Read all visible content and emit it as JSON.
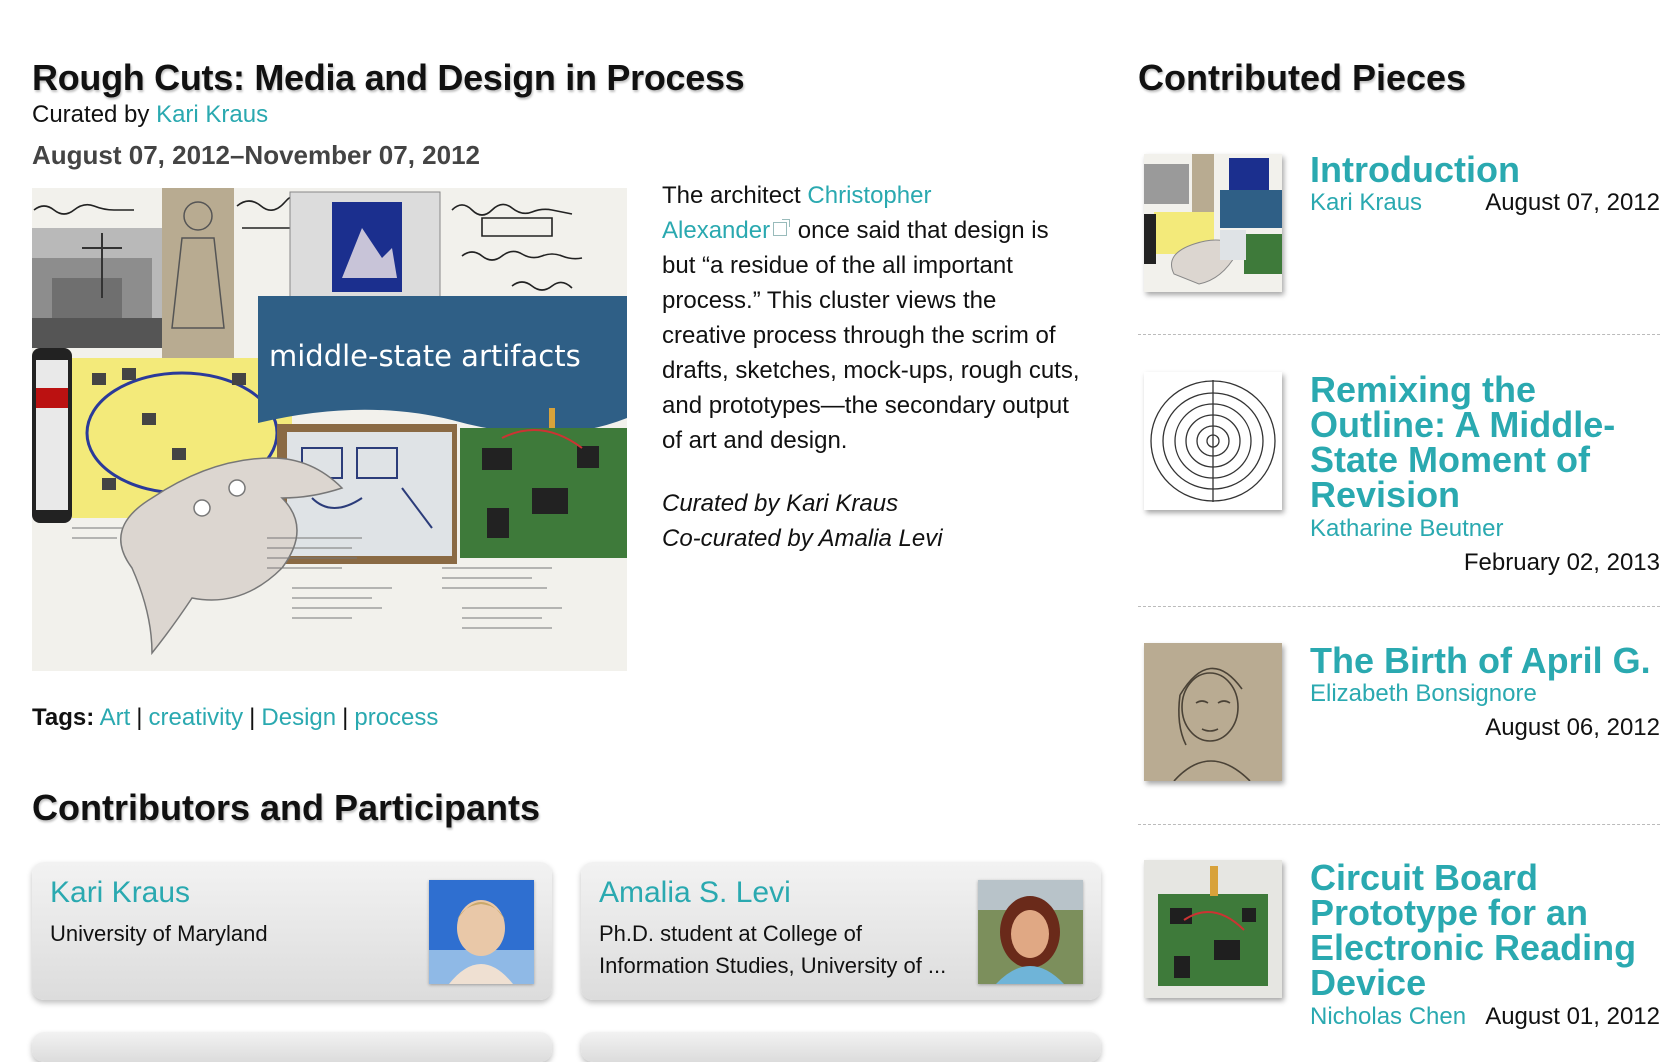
{
  "exhibit": {
    "title": "Rough Cuts: Media and Design in Process",
    "curated_prefix": "Curated by ",
    "curator": "Kari Kraus",
    "date_range": "August 07, 2012–November 07, 2012",
    "image_banner_text": "middle-state artifacts"
  },
  "description": {
    "intro": "The architect ",
    "link_text_1": "Christopher",
    "link_text_2": "Alexander",
    "body": " once said that design is but “a residue of the all important process.” This cluster views the creative process through the scrim of drafts, sketches, mock-ups, rough cuts, and prototypes—the secondary output of art and design.",
    "curated_line": "Curated by Kari Kraus",
    "cocurated_line": "Co-curated by Amalia Levi"
  },
  "tags": {
    "label": "Tags:",
    "items": [
      "Art",
      "creativity",
      "Design",
      "process"
    ]
  },
  "contributors": {
    "heading": "Contributors and Participants",
    "cards": [
      {
        "name": "Kari Kraus",
        "affiliation": "University of Maryland"
      },
      {
        "name": "Amalia S. Levi",
        "affiliation": "Ph.D. student at College of Information Studies, University of ..."
      }
    ]
  },
  "pieces": {
    "heading": "Contributed Pieces",
    "items": [
      {
        "title": "Introduction",
        "author": "Kari Kraus",
        "date": "August 07, 2012"
      },
      {
        "title": "Remixing the Outline: A Middle-State Moment of Revision",
        "author": "Katharine Beutner",
        "date": "February 02, 2013"
      },
      {
        "title": "The Birth of April G.",
        "author": "Elizabeth Bonsignore",
        "date": "August 06, 2012"
      },
      {
        "title": "Circuit Board Prototype for an Electronic Reading Device",
        "author": "Nicholas Chen",
        "date": "August 01, 2012"
      }
    ]
  },
  "colors": {
    "link": "#2aa9b0",
    "banner": "#2f5f86",
    "text": "#111111"
  }
}
